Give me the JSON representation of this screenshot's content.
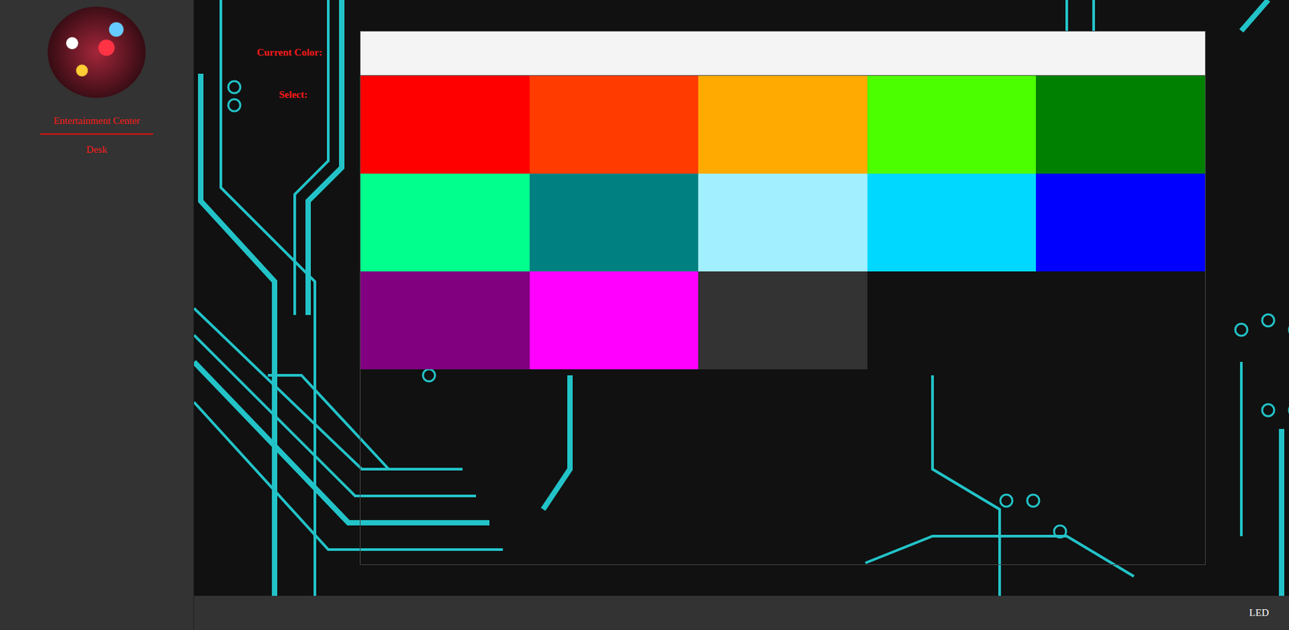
{
  "sidebar": {
    "items": [
      "Entertainment Center",
      "Desk"
    ]
  },
  "current_color": {
    "label": "Current Color:",
    "color": "#f4f4f4"
  },
  "select": {
    "label": "Select:",
    "swatches": [
      {
        "color": "#ff0000"
      },
      {
        "color": "#ff3b00"
      },
      {
        "color": "#ffaa00"
      },
      {
        "color": "#4cff00"
      },
      {
        "color": "#008000"
      },
      {
        "color": "#00ff8c"
      },
      {
        "color": "#008080"
      },
      {
        "color": "#a2f0ff"
      },
      {
        "color": "#00d8ff"
      },
      {
        "color": "#0000ff"
      },
      {
        "color": "#800080"
      },
      {
        "color": "#ff00ff"
      },
      {
        "color": "#333333"
      }
    ]
  },
  "footer": {
    "text": "LED"
  }
}
